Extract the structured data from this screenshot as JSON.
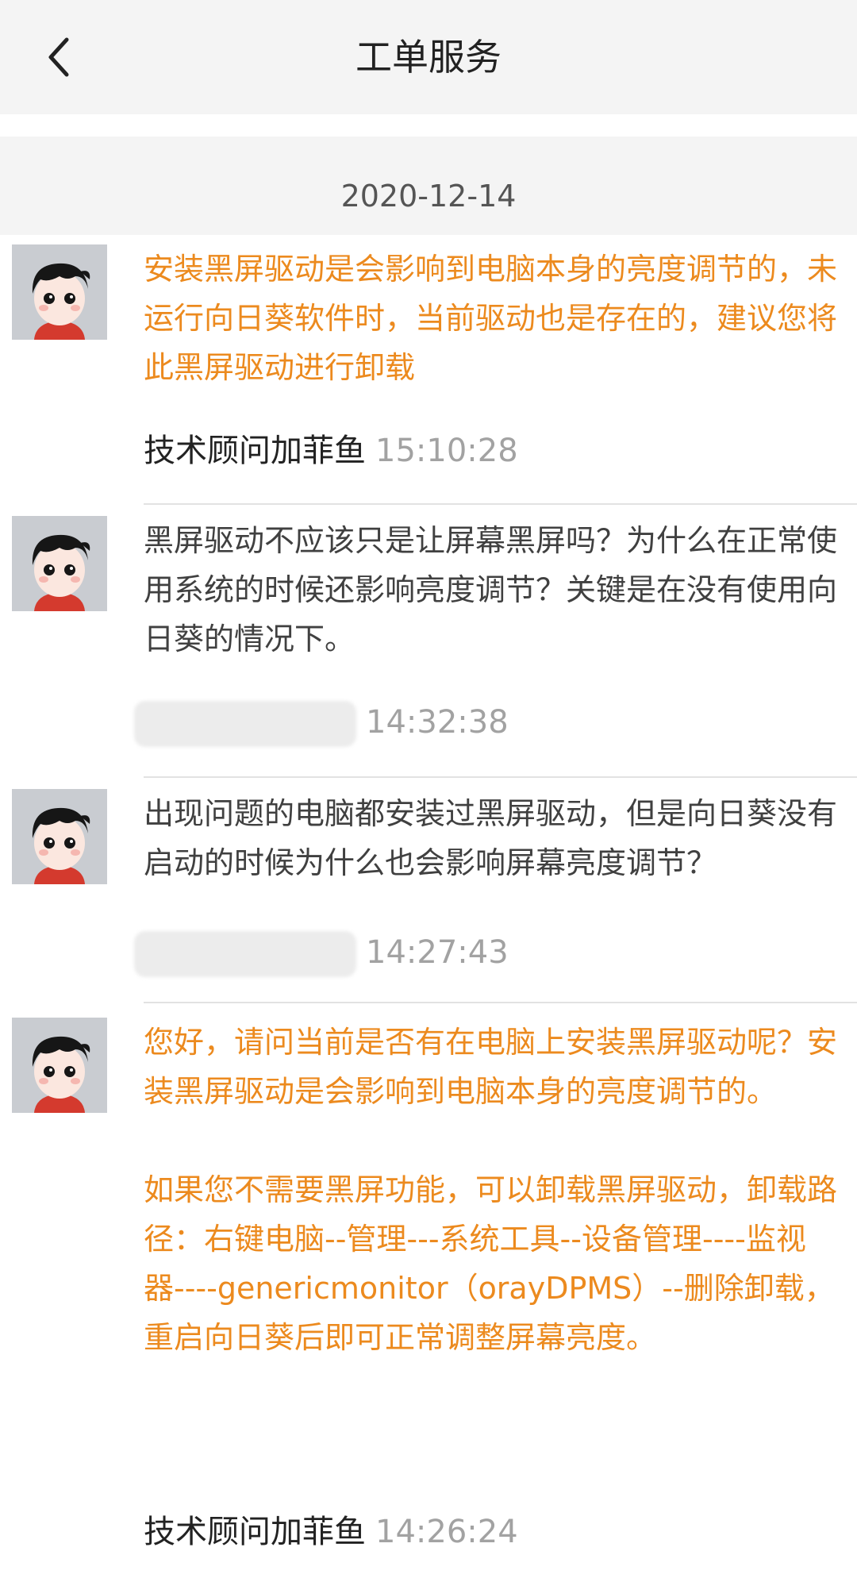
{
  "header": {
    "title": "工单服务",
    "back_icon": "chevron-left-icon"
  },
  "date_separator": "2020-12-14",
  "messages": [
    {
      "role": "staff",
      "text": "安装黑屏驱动是会影响到电脑本身的亮度调节的，未运行向日葵软件时，当前驱动也是存在的，建议您将此黑屏驱动进行卸载",
      "sender": "技术顾问加菲鱼",
      "time": "15:10:28"
    },
    {
      "role": "user",
      "text": "黑屏驱动不应该只是让屏幕黑屏吗？为什么在正常使用系统的时候还影响亮度调节？关键是在没有使用向日葵的情况下。",
      "sender": "",
      "time": "14:32:38"
    },
    {
      "role": "user",
      "text": "出现问题的电脑都安装过黑屏驱动，但是向日葵没有启动的时候为什么也会影响屏幕亮度调节？",
      "sender": "",
      "time": "14:27:43"
    },
    {
      "role": "staff",
      "text": "您好，请问当前是否有在电脑上安装黑屏驱动呢？安装黑屏驱动是会影响到电脑本身的亮度调节的。\n\n如果您不需要黑屏功能，可以卸载黑屏驱动，卸载路径：右键电脑--管理---系统工具--设备管理----监视器----genericmonitor（orayDPMS）--删除卸载，重启向日葵后即可正常调整屏幕亮度。",
      "sender": "技术顾问加菲鱼",
      "time": "14:26:24"
    }
  ],
  "colors": {
    "staff_text": "#ec8a1e",
    "user_text": "#404040",
    "time_text": "#a2a2a2",
    "header_bg": "#f4f4f4"
  }
}
